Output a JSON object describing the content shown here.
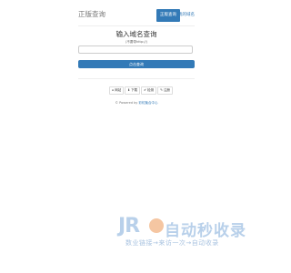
{
  "navbar": {
    "brand": "正版查询",
    "active_tab": "正版查询",
    "link": "我的域名"
  },
  "main": {
    "title": "输入域名查询",
    "hint": "(不要带http://)",
    "input_value": "",
    "input_placeholder": "",
    "button_label": "点击查询"
  },
  "links": [
    {
      "icon": "home-icon",
      "glyph": "⌂",
      "label": "网站"
    },
    {
      "icon": "download-icon",
      "glyph": "⬇",
      "label": "下载"
    },
    {
      "icon": "ok-icon",
      "glyph": "✔",
      "label": "检测"
    },
    {
      "icon": "pencil-icon",
      "glyph": "✎",
      "label": "注册"
    }
  ],
  "footer": {
    "prefix": "© Powered by",
    "link": "彩虹聚合中心"
  },
  "watermark": {
    "letters": "JR",
    "title": "自动秒收录",
    "subtitle": "数业链接→来访一次→自动收录"
  },
  "colors": {
    "primary": "#337ab7",
    "watermark_blue": "#b8d0ea",
    "watermark_orange": "#f2b88b"
  }
}
